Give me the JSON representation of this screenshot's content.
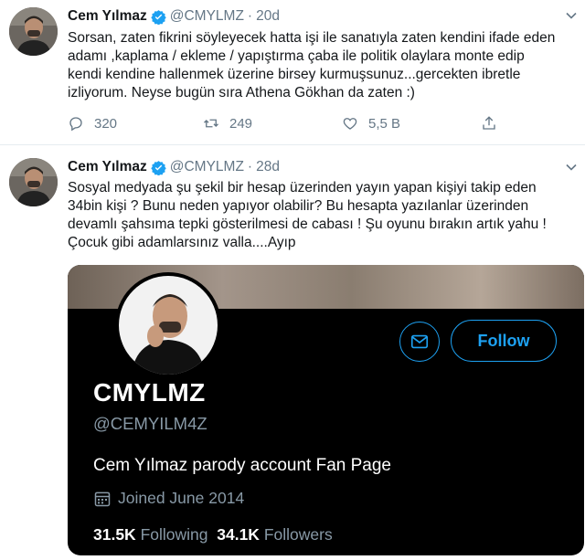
{
  "tweets": [
    {
      "name": "Cem Yılmaz",
      "handle": "@CMYLMZ",
      "separator": "·",
      "time": "20d",
      "lines": [
        "Sorsan, zaten fikrini söyleyecek hatta işi ile sanatıyla zaten kendini ifade eden",
        "adamı ,kaplama / ekleme / yapıştırma çaba ile politik olaylara monte edip",
        "kendi kendine hallenmek üzerine birsey kurmuşsunuz...gercekten ibretle",
        "izliyorum. Neyse bugün sıra Athena Gökhan da zaten :)"
      ],
      "replies": "320",
      "retweets": "249",
      "likes": "5,5 B"
    },
    {
      "name": "Cem Yılmaz",
      "handle": "@CMYLMZ",
      "separator": "·",
      "time": "28d",
      "lines": [
        "Sosyal medyada şu şekil bir hesap üzerinden yayın yapan kişiyi takip eden",
        "34bin kişi ? Bunu neden yapıyor olabilir? Bu hesapta yazılanlar üzerinden",
        "devamlı şahsıma tepki gösterilmesi de cabası ! Şu oyunu bırakın artık yahu !",
        "Çocuk gibi adamlarsınız valla....Ayıp"
      ],
      "card": {
        "display_name": "CMYLMZ",
        "handle": "@CEMYILM4Z",
        "bio": "Cem Yılmaz parody account Fan Page",
        "joined": "Joined June 2014",
        "following_count": "31.5K",
        "following_label": "Following",
        "followers_count": "34.1K",
        "followers_label": "Followers",
        "follow_button": "Follow",
        "icons": [
          "mail-icon",
          "calendar-icon"
        ]
      }
    }
  ],
  "colors": {
    "accent": "#1da1f2",
    "muted": "#657786",
    "card_bg": "#000000"
  }
}
